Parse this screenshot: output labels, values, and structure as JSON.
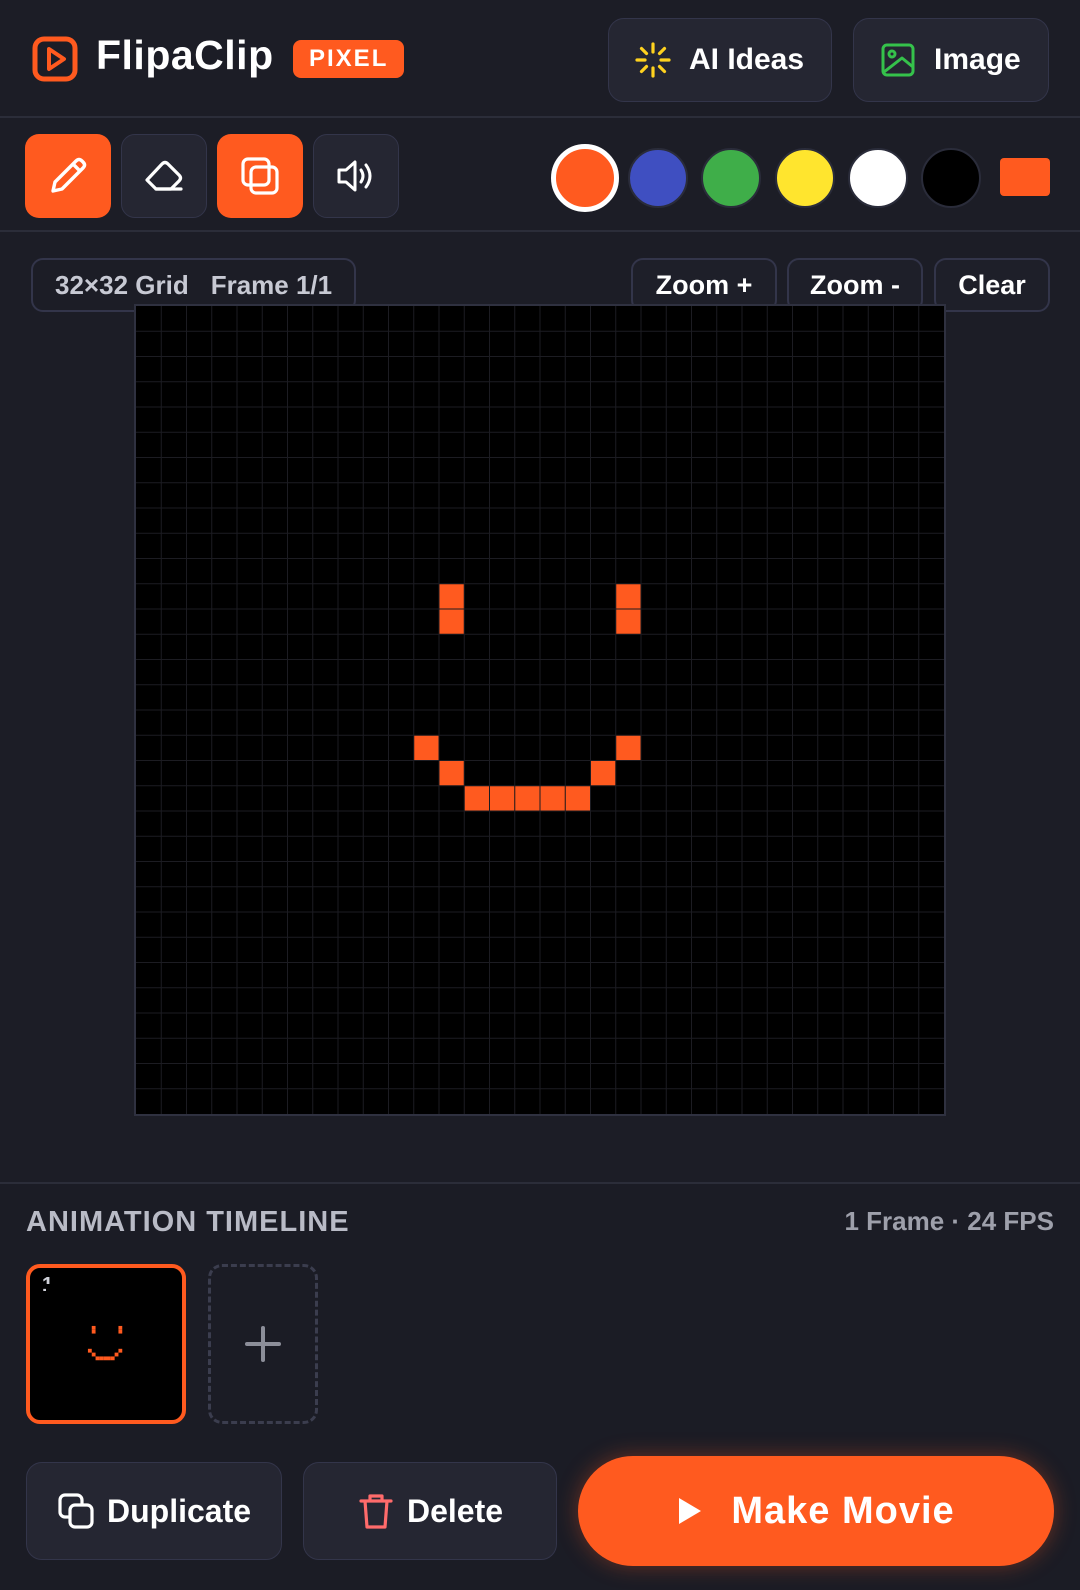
{
  "header": {
    "app_name": "FlipaClip",
    "badge": "PIXEL",
    "ai_ideas_label": "AI Ideas",
    "image_label": "Image"
  },
  "toolbar": {
    "tools": [
      {
        "name": "pencil-icon",
        "active": true
      },
      {
        "name": "eraser-icon",
        "active": false
      },
      {
        "name": "layers-icon",
        "active": true
      },
      {
        "name": "sound-icon",
        "active": false
      }
    ],
    "palette": [
      "#ff5a1f",
      "#3f4fc1",
      "#3fae49",
      "#ffe52e",
      "#ffffff",
      "#000000"
    ],
    "selected_color": "#ff5a1f"
  },
  "canvas": {
    "grid_label": "32×32 Grid",
    "frame_label": "Frame 1/1",
    "zoom_in_label": "Zoom +",
    "zoom_out_label": "Zoom -",
    "clear_label": "Clear",
    "grid_size": 32,
    "pixel_color": "#ff5a1f",
    "pixels": [
      [
        12,
        11
      ],
      [
        12,
        12
      ],
      [
        19,
        11
      ],
      [
        19,
        12
      ],
      [
        11,
        17
      ],
      [
        19,
        17
      ],
      [
        12,
        18
      ],
      [
        18,
        18
      ],
      [
        13,
        19
      ],
      [
        14,
        19
      ],
      [
        15,
        19
      ],
      [
        16,
        19
      ],
      [
        17,
        19
      ]
    ]
  },
  "timeline": {
    "title": "ANIMATION TIMELINE",
    "info": "1 Frame · 24 FPS",
    "frames": [
      {
        "number": "1"
      }
    ],
    "duplicate_label": "Duplicate",
    "delete_label": "Delete",
    "make_movie_label": "Make Movie"
  },
  "colors": {
    "accent": "#ff5a1f",
    "background": "#1c1d26",
    "panel": "#252632"
  }
}
